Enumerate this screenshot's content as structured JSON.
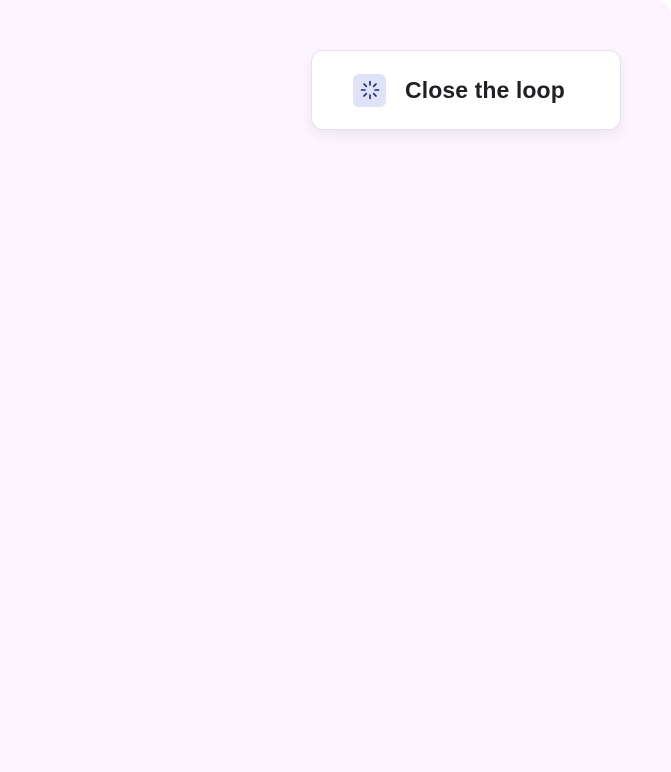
{
  "task_card": {
    "title": "Close the loop",
    "icon": "loading-spinner-icon"
  },
  "colors": {
    "page_background": "#fcf5fd",
    "card_background": "#ffffff",
    "card_border": "#e7e1ea",
    "icon_background": "#dee3f8",
    "icon_stroke": "#1f2a66",
    "text": "#202124"
  }
}
